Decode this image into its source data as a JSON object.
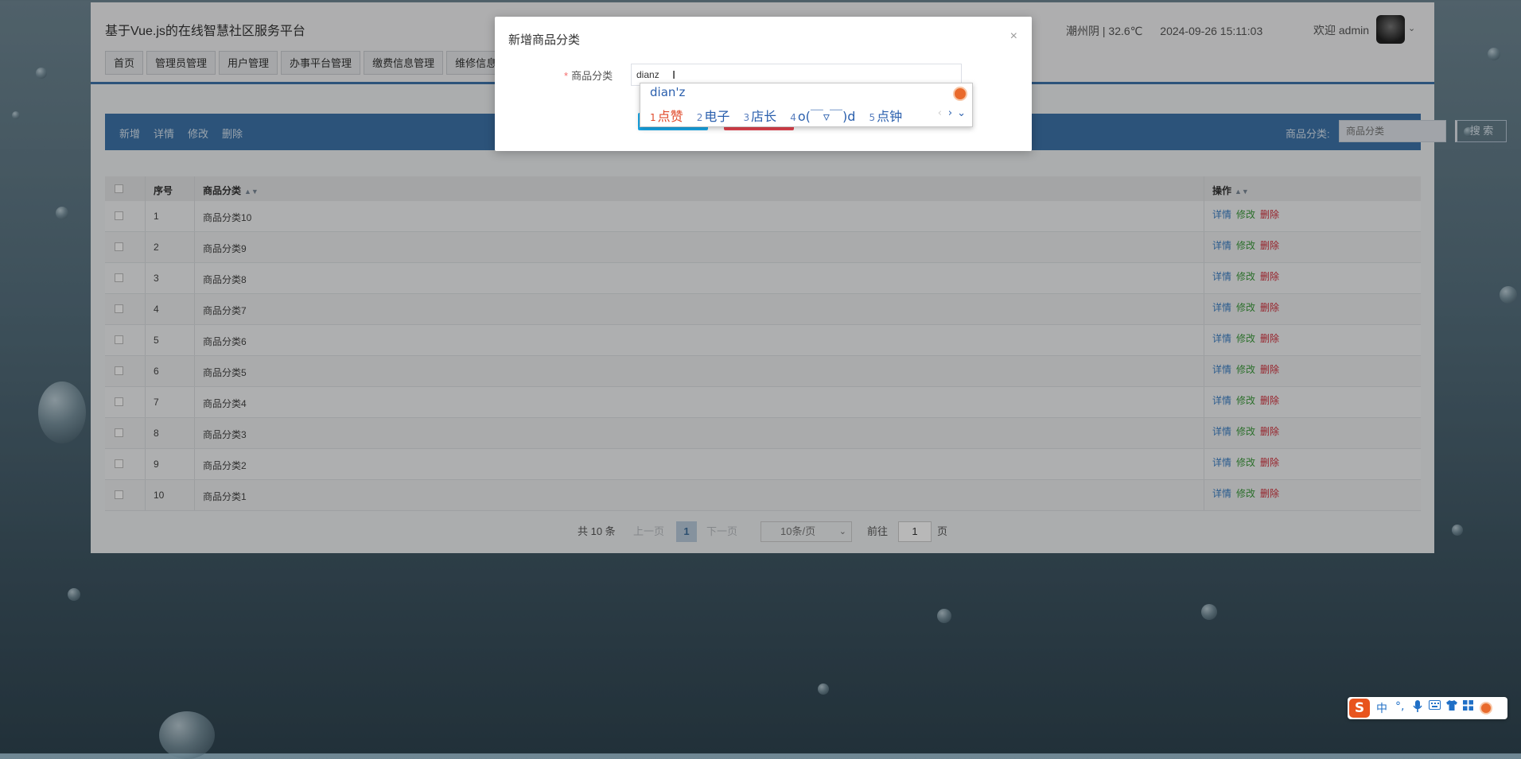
{
  "app": {
    "title": "基于Vue.js的在线智慧社区服务平台",
    "weather": "潮州阴 | 32.6℃",
    "datetime": "2024-09-26  15:11:03",
    "welcome": "欢迎 admin"
  },
  "nav": {
    "tabs": [
      "首页",
      "管理员管理",
      "用户管理",
      "办事平台管理",
      "缴费信息管理",
      "维修信息管理"
    ]
  },
  "toolbar": {
    "add": "新增",
    "detail": "详情",
    "edit": "修改",
    "delete": "删除",
    "search_label": "商品分类:",
    "search_placeholder": "商品分类",
    "search_button": "搜 索"
  },
  "table": {
    "headers": {
      "no": "序号",
      "name": "商品分类",
      "ops": "操作"
    },
    "rows": [
      {
        "no": "1",
        "name": "商品分类10"
      },
      {
        "no": "2",
        "name": "商品分类9"
      },
      {
        "no": "3",
        "name": "商品分类8"
      },
      {
        "no": "4",
        "name": "商品分类7"
      },
      {
        "no": "5",
        "name": "商品分类6"
      },
      {
        "no": "6",
        "name": "商品分类5"
      },
      {
        "no": "7",
        "name": "商品分类4"
      },
      {
        "no": "8",
        "name": "商品分类3"
      },
      {
        "no": "9",
        "name": "商品分类2"
      },
      {
        "no": "10",
        "name": "商品分类1"
      }
    ],
    "row_ops": {
      "detail": "详情",
      "edit": "修改",
      "delete": "删除"
    }
  },
  "pager": {
    "total": "共 10 条",
    "prev": "上一页",
    "current": "1",
    "next": "下一页",
    "page_size": "10条/页",
    "goto_label": "前往",
    "goto_value": "1",
    "goto_suffix": "页"
  },
  "dialog": {
    "title": "新增商品分类",
    "close": "×",
    "field_label": "商品分类",
    "required_mark": "*",
    "field_value": "dianz"
  },
  "ime": {
    "composition": "dian'z",
    "candidates": [
      {
        "n": "1",
        "text": "点赞"
      },
      {
        "n": "2",
        "text": "电子"
      },
      {
        "n": "3",
        "text": "店长"
      },
      {
        "n": "4",
        "text": "o(￣▿￣)d"
      },
      {
        "n": "5",
        "text": "点钟"
      }
    ],
    "prev": "‹",
    "next": "›",
    "expand": "⌄"
  },
  "ime_bar": {
    "logo": "S",
    "mode": "中",
    "punct": "°,"
  },
  "colors": {
    "header_blue": "#3d74aa",
    "submit": "#19a9ea",
    "cancel": "#e54450",
    "ime_red": "#e04a2a",
    "ime_blue": "#2a5fad"
  }
}
